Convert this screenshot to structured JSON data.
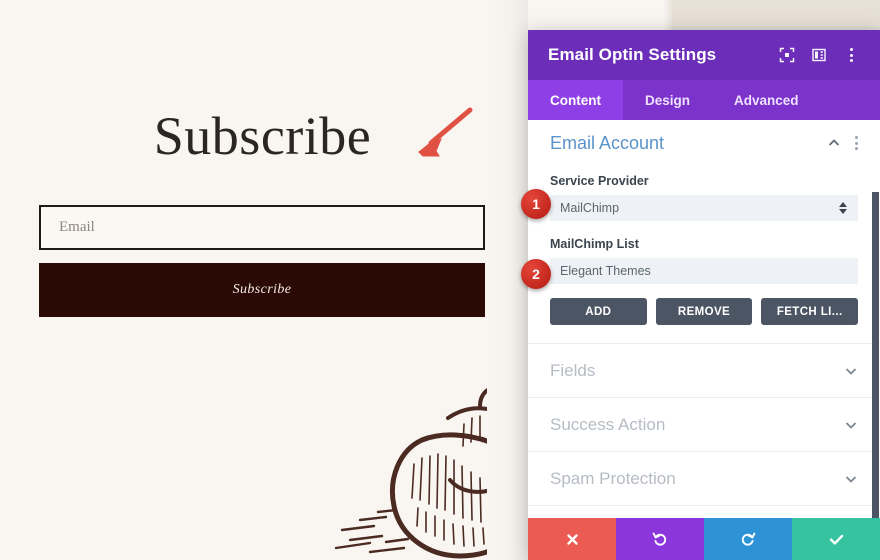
{
  "website": {
    "heading": "Subscribe",
    "email_placeholder": "Email",
    "subscribe_button": "Subscribe",
    "background_color": "#f9f6f2",
    "button_color": "#2b0a06",
    "annotation_arrow_color": "#e05043"
  },
  "panel": {
    "title": "Email Optin Settings",
    "header_color": "#6c2eb9",
    "tabs_color": "#7b33cc",
    "active_tab_color": "#8f3fe6",
    "header_icons": [
      {
        "name": "fullscreen-icon",
        "label": "Expand"
      },
      {
        "name": "layout-columns-icon",
        "label": "Layout"
      },
      {
        "name": "more-options-icon",
        "label": "More"
      }
    ],
    "tabs": [
      {
        "label": "Content",
        "active": true
      },
      {
        "label": "Design",
        "active": false
      },
      {
        "label": "Advanced",
        "active": false
      }
    ],
    "open_section": {
      "title": "Email Account",
      "title_color": "#5a93c9",
      "fields": [
        {
          "label": "Service Provider",
          "value": "MailChimp",
          "type": "select",
          "badge": "1"
        },
        {
          "label": "MailChimp List",
          "value": "Elegant Themes",
          "type": "select",
          "badge": "2"
        }
      ],
      "buttons": [
        {
          "label": "ADD",
          "name": "add-button"
        },
        {
          "label": "REMOVE",
          "name": "remove-button"
        },
        {
          "label": "FETCH LI...",
          "name": "fetch-lists-button"
        }
      ]
    },
    "collapsed_sections": [
      {
        "title": "Fields"
      },
      {
        "title": "Success Action"
      },
      {
        "title": "Spam Protection"
      }
    ],
    "footer_buttons": [
      {
        "name": "cancel-button",
        "icon": "close-icon",
        "color": "#ec5b53"
      },
      {
        "name": "undo-button",
        "icon": "undo-icon",
        "color": "#8b36dd"
      },
      {
        "name": "redo-button",
        "icon": "redo-icon",
        "color": "#2e92d6"
      },
      {
        "name": "save-button",
        "icon": "check-icon",
        "color": "#35c3a0"
      }
    ]
  },
  "callouts": [
    {
      "number": "1"
    },
    {
      "number": "2"
    }
  ]
}
